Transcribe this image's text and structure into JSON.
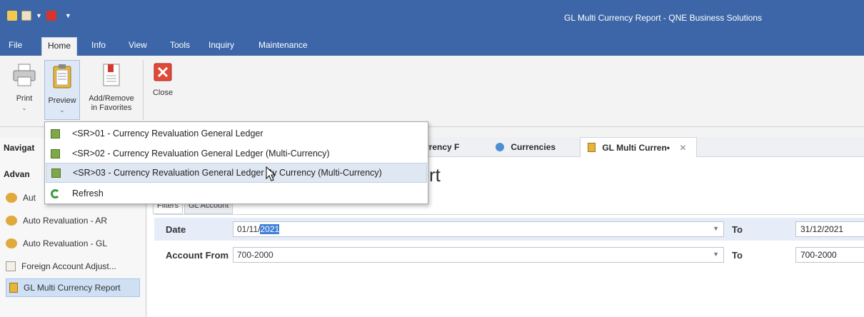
{
  "window": {
    "title": "GL Multi Currency Report - QNE Business Solutions"
  },
  "menu": {
    "items": [
      "File",
      "Home",
      "Info",
      "View",
      "Tools",
      "Inquiry",
      "Maintenance"
    ],
    "active": "Home"
  },
  "ribbon": {
    "print": "Print",
    "preview": "Preview",
    "add_remove_line1": "Add/Remove",
    "add_remove_line2": "in Favorites",
    "close": "Close"
  },
  "preview_menu": {
    "items": [
      "<SR>01 - Currency Revaluation General Ledger",
      "<SR>02 - Currency Revaluation General Ledger (Multi-Currency)",
      "<SR>03 - Currency Revaluation General Ledger By Currency (Multi-Currency)",
      "Refresh"
    ],
    "highlighted_index": 2
  },
  "tabs": {
    "navigation_partial": "Navigat",
    "currency_partial": "rrency F",
    "currencies": "Currencies",
    "gl_multi": "GL Multi Curren•"
  },
  "nav": {
    "heading_partial": "Advan",
    "items": [
      "Aut",
      "Auto Revaluation - AR",
      "Auto Revaluation - GL",
      "Foreign Account Adjust...",
      "GL Multi Currency Report"
    ],
    "selected_index": 4
  },
  "report": {
    "title_partial": "rt",
    "subtabs": [
      "Filters",
      "GL Account"
    ],
    "date_label": "Date",
    "date_from_prefix": "01/11/",
    "date_from_selected": "2021",
    "date_to_label": "To",
    "date_to": "31/12/2021",
    "account_label": "Account From",
    "account_from": "700-2000",
    "account_to_label": "To",
    "account_to": "700-2000"
  },
  "colors": {
    "titlebar": "#3c66a8",
    "selection": "#3f7fd8",
    "highlight": "#dfe7f2"
  }
}
